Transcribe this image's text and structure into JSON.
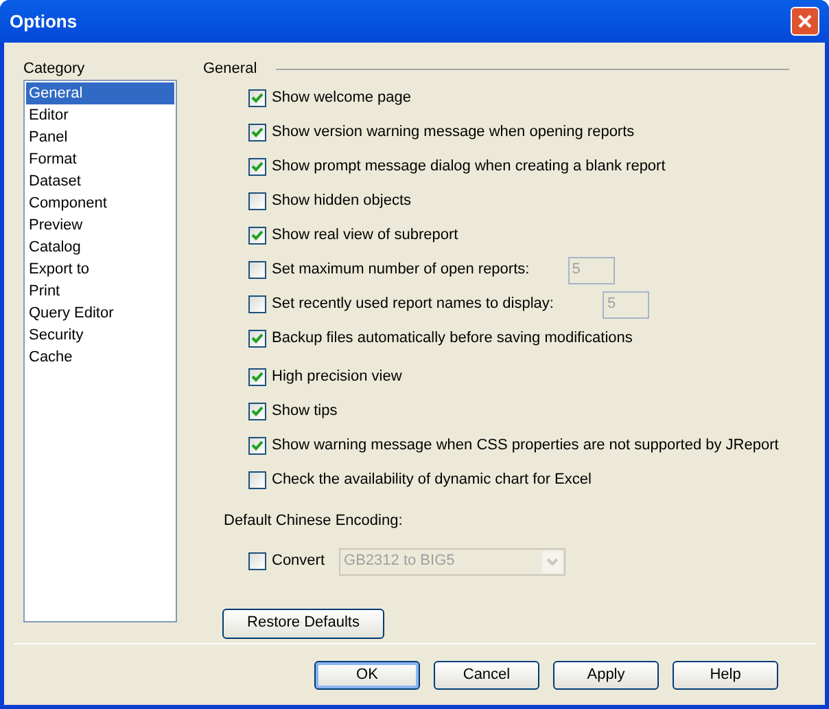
{
  "window": {
    "title": "Options"
  },
  "category": {
    "label": "Category",
    "items": [
      {
        "label": "General",
        "selected": true
      },
      {
        "label": "Editor",
        "selected": false
      },
      {
        "label": "Panel",
        "selected": false
      },
      {
        "label": "Format",
        "selected": false
      },
      {
        "label": "Dataset",
        "selected": false
      },
      {
        "label": "Component",
        "selected": false
      },
      {
        "label": "Preview",
        "selected": false
      },
      {
        "label": "Catalog",
        "selected": false
      },
      {
        "label": "Export to",
        "selected": false
      },
      {
        "label": "Print",
        "selected": false
      },
      {
        "label": "Query Editor",
        "selected": false
      },
      {
        "label": "Security",
        "selected": false
      },
      {
        "label": "Cache",
        "selected": false
      }
    ]
  },
  "general": {
    "title": "General",
    "options": [
      {
        "kind": "check",
        "label": "Show welcome page",
        "checked": true
      },
      {
        "kind": "check",
        "label": "Show version warning message when opening reports",
        "checked": true
      },
      {
        "kind": "check",
        "label": "Show prompt message dialog when creating a blank report",
        "checked": true
      },
      {
        "kind": "check",
        "label": "Show hidden objects",
        "checked": false
      },
      {
        "kind": "check",
        "label": "Show real view of subreport",
        "checked": true
      },
      {
        "kind": "number",
        "label": "Set maximum number of open reports:",
        "checked": false,
        "value": "5"
      },
      {
        "kind": "number",
        "label": "Set recently used report names to display:",
        "checked": false,
        "value": "5"
      },
      {
        "kind": "check",
        "label": "Backup files automatically before saving modifications",
        "checked": true
      },
      {
        "kind": "check",
        "label": "High precision view",
        "checked": true
      },
      {
        "kind": "check",
        "label": "Show tips",
        "checked": true
      },
      {
        "kind": "check",
        "label": "Show warning message when CSS properties are not supported by JReport",
        "checked": true
      },
      {
        "kind": "check",
        "label": "Check the availability of dynamic chart for Excel",
        "checked": false
      }
    ],
    "encoding": {
      "label": "Default Chinese Encoding:",
      "convert": {
        "label": "Convert",
        "checked": false
      },
      "select": {
        "value": "GB2312 to BIG5",
        "disabled": true
      }
    },
    "restore_button": "Restore Defaults"
  },
  "buttons": [
    {
      "label": "OK",
      "default": true
    },
    {
      "label": "Cancel",
      "default": false
    },
    {
      "label": "Apply",
      "default": false
    },
    {
      "label": "Help",
      "default": false
    }
  ]
}
